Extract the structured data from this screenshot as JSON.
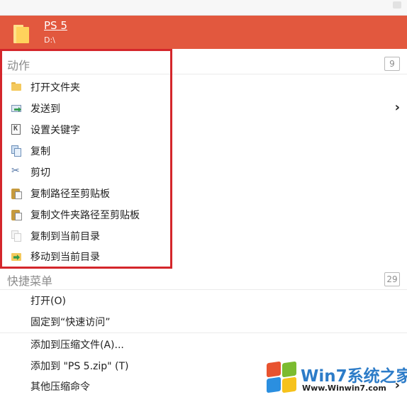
{
  "result": {
    "title": "PS 5",
    "path": "D:\\",
    "icon": "folder-icon"
  },
  "actions_section": {
    "label": "动作",
    "count": "9",
    "items": [
      {
        "label": "打开文件夹",
        "icon": "folder-open-icon",
        "has_submenu": false
      },
      {
        "label": "发送到",
        "icon": "send-to-icon",
        "has_submenu": true
      },
      {
        "label": "设置关键字",
        "icon": "keyword-icon",
        "has_submenu": false
      },
      {
        "label": "复制",
        "icon": "copy-icon",
        "has_submenu": false
      },
      {
        "label": "剪切",
        "icon": "scissors-icon",
        "has_submenu": false
      },
      {
        "label": "复制路径至剪贴板",
        "icon": "clipboard-icon",
        "has_submenu": false
      },
      {
        "label": "复制文件夹路径至剪贴板",
        "icon": "clipboard-icon",
        "has_submenu": false
      },
      {
        "label": "复制到当前目录",
        "icon": "copy-here-icon",
        "has_submenu": false
      },
      {
        "label": "移动到当前目录",
        "icon": "move-here-icon",
        "has_submenu": false
      }
    ]
  },
  "quick_menu_section": {
    "label": "快捷菜单",
    "count": "29",
    "items": [
      {
        "label": "打开(O)",
        "has_submenu": false
      },
      {
        "label": "固定到“快速访问”",
        "has_submenu": false
      },
      {
        "label": "添加到压缩文件(A)...",
        "has_submenu": false
      },
      {
        "label": "添加到 \"PS 5.zip\" (T)",
        "has_submenu": false
      },
      {
        "label": "其他压缩命令",
        "has_submenu": true
      }
    ]
  },
  "watermark": {
    "brand": "Win7系统之家",
    "url": "Www.Winwin7.com"
  },
  "colors": {
    "selected_bg": "#e2583e",
    "highlight_box": "#d4262b",
    "section_text": "#8c8c8c"
  }
}
